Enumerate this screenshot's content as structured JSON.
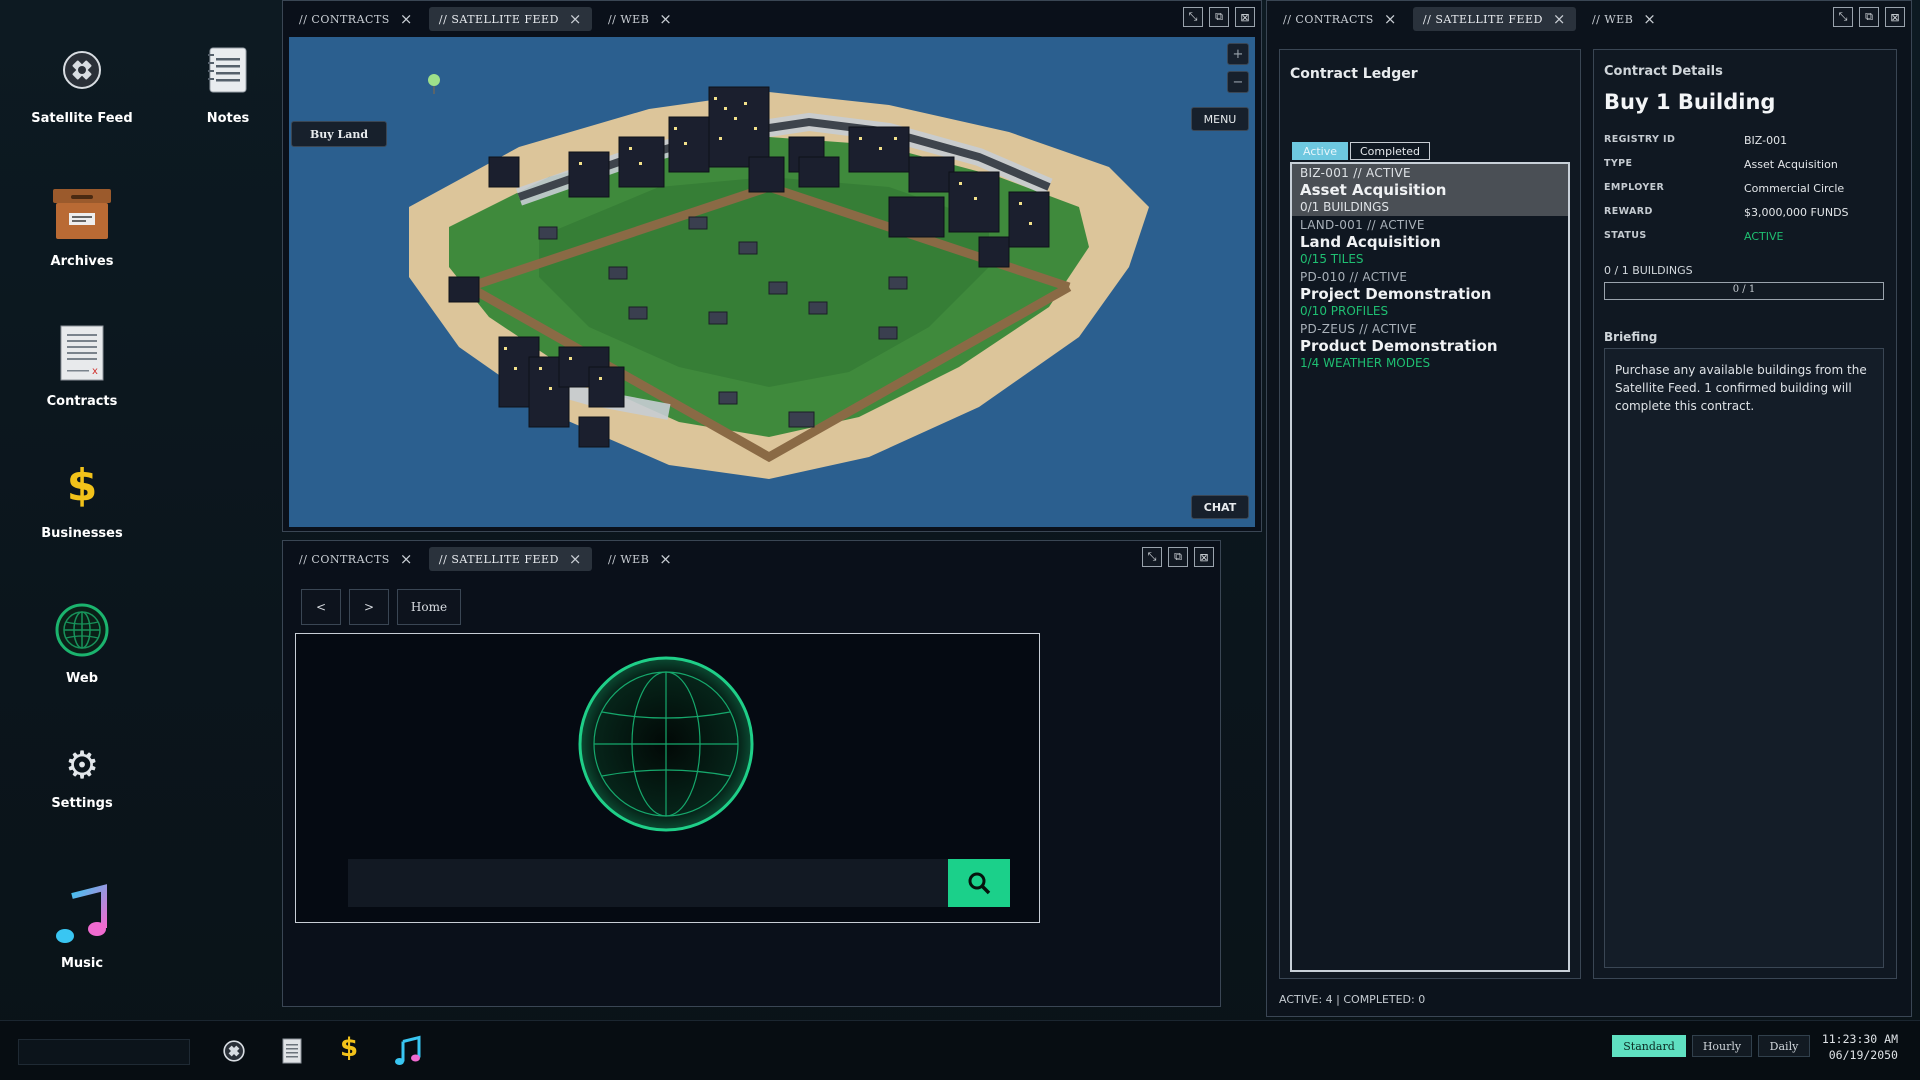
{
  "desktop": {
    "icons": [
      {
        "label": "Satellite Feed",
        "icon": "satellite-icon"
      },
      {
        "label": "Notes",
        "icon": "notes-icon"
      },
      {
        "label": "Archives",
        "icon": "archive-box-icon"
      },
      {
        "label": "Contracts",
        "icon": "contract-document-icon"
      },
      {
        "label": "Businesses",
        "icon": "dollar-icon"
      },
      {
        "label": "Web",
        "icon": "globe-icon"
      },
      {
        "label": "Settings",
        "icon": "gear-icon"
      },
      {
        "label": "Music",
        "icon": "music-note-icon"
      }
    ]
  },
  "tabs": {
    "contracts": "// CONTRACTS",
    "satellite": "// SATELLITE FEED",
    "web": "// WEB"
  },
  "satellite_window": {
    "buy_land": "Buy Land",
    "menu": "MENU",
    "chat": "CHAT",
    "zoom_in": "+",
    "zoom_out": "−"
  },
  "web_window": {
    "back": "<",
    "forward": ">",
    "home": "Home",
    "search_placeholder": ""
  },
  "contracts_window": {
    "ledger_title": "Contract Ledger",
    "tab_active": "Active",
    "tab_completed": "Completed",
    "entries": [
      {
        "code": "BIZ-001 // ACTIVE",
        "name": "Asset Acquisition",
        "progress": "0/1 BUILDINGS"
      },
      {
        "code": "LAND-001 // ACTIVE",
        "name": "Land Acquisition",
        "progress": "0/15 TILES"
      },
      {
        "code": "PD-010 // ACTIVE",
        "name": "Project Demonstration",
        "progress": "0/10 PROFILES"
      },
      {
        "code": "PD-ZEUS // ACTIVE",
        "name": "Product Demonstration",
        "progress": "1/4 WEATHER MODES"
      }
    ],
    "footer": "ACTIVE: 4 | COMPLETED: 0",
    "details": {
      "header": "Contract Details",
      "title": "Buy 1 Building",
      "fields": [
        {
          "key": "REGISTRY ID",
          "value": "BIZ-001"
        },
        {
          "key": "TYPE",
          "value": "Asset Acquisition"
        },
        {
          "key": "EMPLOYER",
          "value": "Commercial Circle"
        },
        {
          "key": "REWARD",
          "value": "$3,000,000 FUNDS"
        },
        {
          "key": "STATUS",
          "value": "ACTIVE"
        }
      ],
      "progress_label": "0 / 1 BUILDINGS",
      "progress_text": "0 / 1",
      "progress_fraction": 0,
      "briefing_label": "Briefing",
      "briefing_text": "Purchase any available buildings from the Satellite Feed. 1 confirmed building will complete this contract."
    }
  },
  "taskbar": {
    "speeds": [
      "Standard",
      "Hourly",
      "Daily"
    ],
    "selected_speed": "Standard",
    "time": "11:23:30 AM",
    "date": "06/19/2050"
  },
  "colors": {
    "accent_green": "#1fbf72",
    "search_green": "#1bd08a",
    "ocean": "#2b5f8f",
    "speed_on": "#5fe0c1"
  }
}
